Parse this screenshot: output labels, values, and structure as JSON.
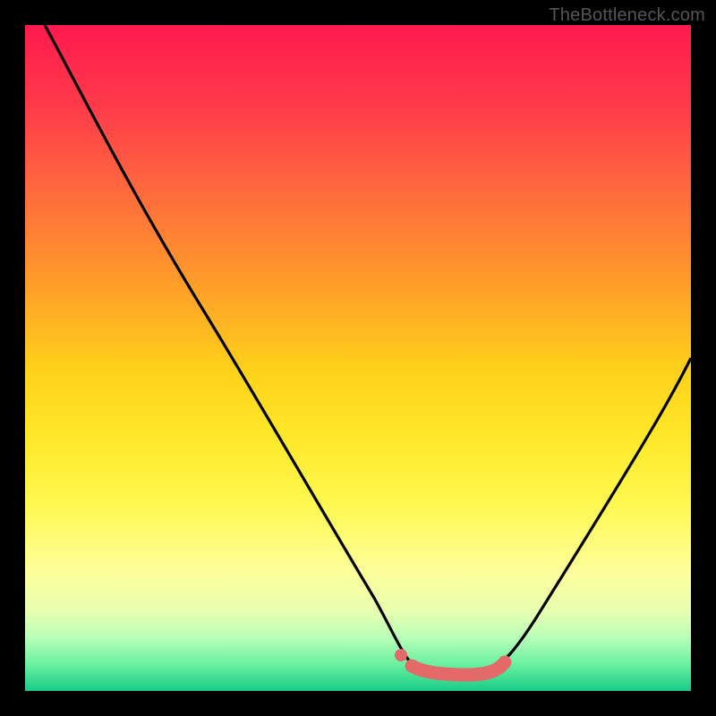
{
  "watermark": "TheBottleneck.com",
  "colors": {
    "background": "#000000",
    "gradient_top": "#ff1a4d",
    "gradient_bottom": "#18cc88",
    "curve": "#000000",
    "marker": "#e86a6a"
  },
  "chart_data": {
    "type": "line",
    "title": "",
    "xlabel": "",
    "ylabel": "",
    "xlim": [
      0,
      100
    ],
    "ylim": [
      0,
      100
    ],
    "series": [
      {
        "name": "bottleneck-curve",
        "x": [
          3,
          10,
          20,
          30,
          40,
          50,
          55,
          58,
          62,
          68,
          72,
          80,
          90,
          100
        ],
        "y": [
          100,
          88,
          70,
          53,
          37,
          20,
          10,
          4,
          2,
          2,
          5,
          15,
          32,
          52
        ]
      }
    ],
    "markers": [
      {
        "name": "optimum-start-dot",
        "x": 56,
        "y": 6
      },
      {
        "name": "optimum-range-bar",
        "x_start": 58,
        "x_end": 72,
        "y": 3
      }
    ]
  }
}
